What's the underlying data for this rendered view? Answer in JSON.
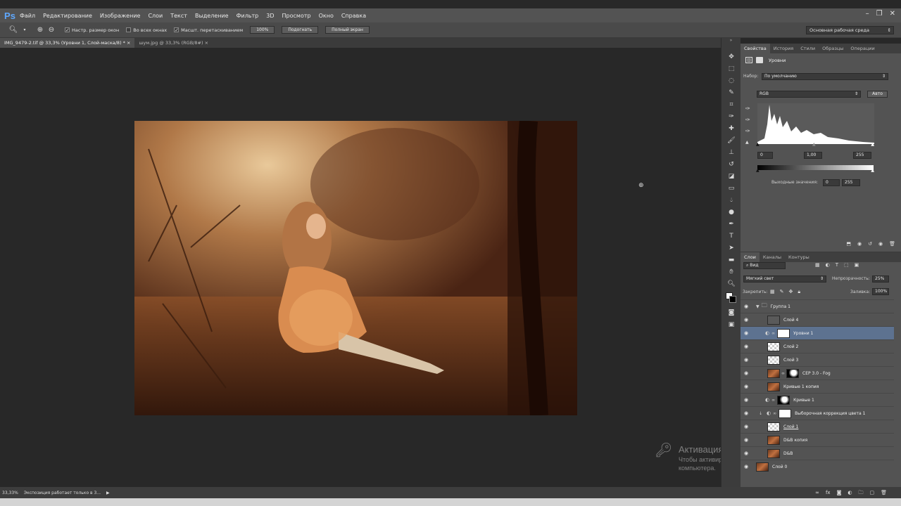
{
  "app": {
    "logo": "Ps"
  },
  "menu": [
    "Файл",
    "Редактирование",
    "Изображение",
    "Слои",
    "Текст",
    "Выделение",
    "Фильтр",
    "3D",
    "Просмотр",
    "Окно",
    "Справка"
  ],
  "options": {
    "resize_windows": "Настр. размер окон",
    "all_windows": "Во всех окнах",
    "scrubby_zoom": "Масшт. перетаскиванием",
    "btn_100": "100%",
    "btn_fit": "Подогнать",
    "btn_fullscreen": "Полный экран",
    "workspace": "Основная рабочая среда"
  },
  "tabs": [
    {
      "label": "IMG_9479-2.tif @ 33,3% (Уровни 1, Слой-маска/8) *",
      "close": "×"
    },
    {
      "label": "шум.jpg @ 33,3% (RGB/8#)",
      "close": "×"
    }
  ],
  "properties": {
    "tabs": [
      "Свойства",
      "История",
      "Стили",
      "Образцы",
      "Операции"
    ],
    "title": "Уровни",
    "preset_label": "Набор:",
    "preset_value": "По умолчанию",
    "channel": "RGB",
    "auto_button": "Авто",
    "input_black": "0",
    "input_gamma": "1,00",
    "input_white": "255",
    "output_label": "Выходные значения:",
    "output_black": "0",
    "output_white": "255"
  },
  "layers_panel": {
    "tabs": [
      "Слои",
      "Каналы",
      "Контуры"
    ],
    "filter": "Вид",
    "blend_mode": "Мягкий свет",
    "opacity_label": "Непрозрачность:",
    "opacity_value": "25%",
    "lock_label": "Закрепить:",
    "fill_label": "Заливка:",
    "fill_value": "100%",
    "layers": [
      {
        "name": "Группа 1"
      },
      {
        "name": "Слой 4"
      },
      {
        "name": "Уровни 1"
      },
      {
        "name": "Слой 2"
      },
      {
        "name": "Слой 3"
      },
      {
        "name": "CEP 3.0 - Fog"
      },
      {
        "name": "Кривые 1 копия"
      },
      {
        "name": "Кривые 1"
      },
      {
        "name": "Выборочная коррекция цвета 1"
      },
      {
        "name": "Слой 1"
      },
      {
        "name": "D&B копия"
      },
      {
        "name": "D&B"
      },
      {
        "name": "Слой 0"
      }
    ]
  },
  "status": {
    "zoom": "33,33%",
    "message": "Экспозиция работает только в 3..."
  },
  "watermark": {
    "title": "Активация Windows",
    "line1": "Чтобы активировать Windows, перейдите к параметрам",
    "line2": "компьютера."
  }
}
